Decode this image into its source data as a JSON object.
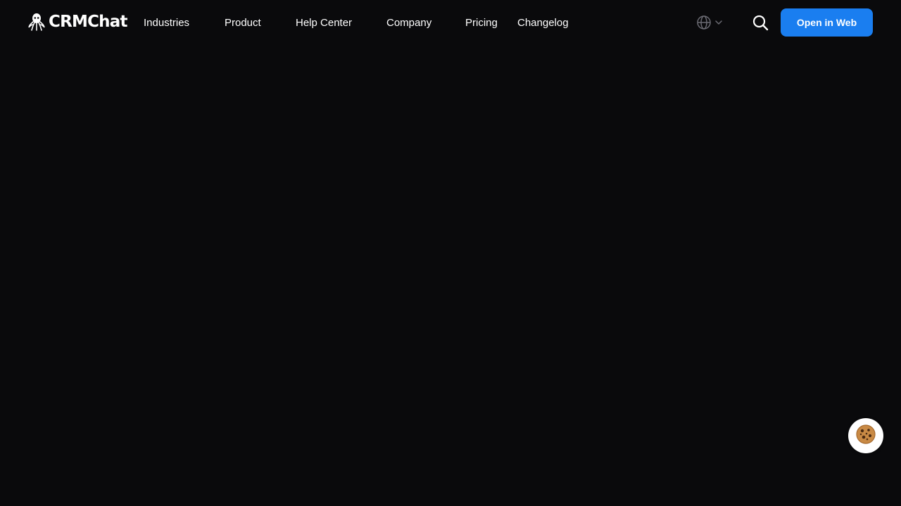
{
  "brand": {
    "name": "CRMChat",
    "logo_icon": "octopus-icon"
  },
  "nav": {
    "items": [
      {
        "label": "Industries"
      },
      {
        "label": "Product"
      },
      {
        "label": "Help Center"
      },
      {
        "label": "Company"
      },
      {
        "label": "Pricing"
      },
      {
        "label": "Changelog"
      }
    ]
  },
  "header_actions": {
    "language_icon": "globe-icon",
    "language_dropdown_icon": "chevron-down-icon",
    "search_icon": "search-icon",
    "cta_label": "Open in Web"
  },
  "cookie_button": {
    "icon": "cookie-icon"
  },
  "colors": {
    "background": "#0a0a0c",
    "accent": "#1a7ef0",
    "text": "#ffffff",
    "muted_icon": "#6b6b73"
  }
}
